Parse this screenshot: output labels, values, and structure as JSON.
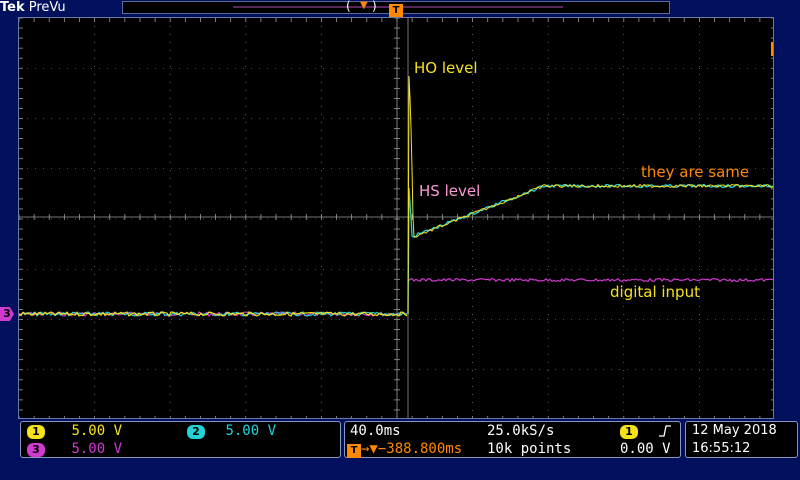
{
  "header": {
    "brand": "Tek",
    "mode": "PreVu",
    "trigger_icon": "T"
  },
  "markers": {
    "channel3_label": "3",
    "trigger_label": "T",
    "trigger_position_label": "T"
  },
  "annotations": {
    "ho_level": "HO level",
    "hs_level": "HS level",
    "same": "they are same",
    "digital": "digital input"
  },
  "channels": [
    {
      "id": "1",
      "scale": "5.00 V",
      "color": "#f5e21b"
    },
    {
      "id": "2",
      "scale": "5.00 V",
      "color": "#22d3d8"
    },
    {
      "id": "3",
      "scale": "5.00 V",
      "color": "#d03ad0"
    }
  ],
  "timebase": {
    "time_div": "40.0ms",
    "sample_rate": "25.0kS/s",
    "position": "→▼−388.800ms",
    "record": "10k points"
  },
  "trigger": {
    "source": "1",
    "slope": "rising-edge-icon",
    "level": "0.00 V"
  },
  "datetime": {
    "date": "12 May 2018",
    "time": "16:55:12"
  },
  "colors": {
    "background": "#00105c",
    "grid": "#9a9a9a",
    "ch1": "#f5e21b",
    "ch2": "#22d3d8",
    "ch3": "#d03ad0",
    "annotation_orange": "#ff8a00"
  }
}
